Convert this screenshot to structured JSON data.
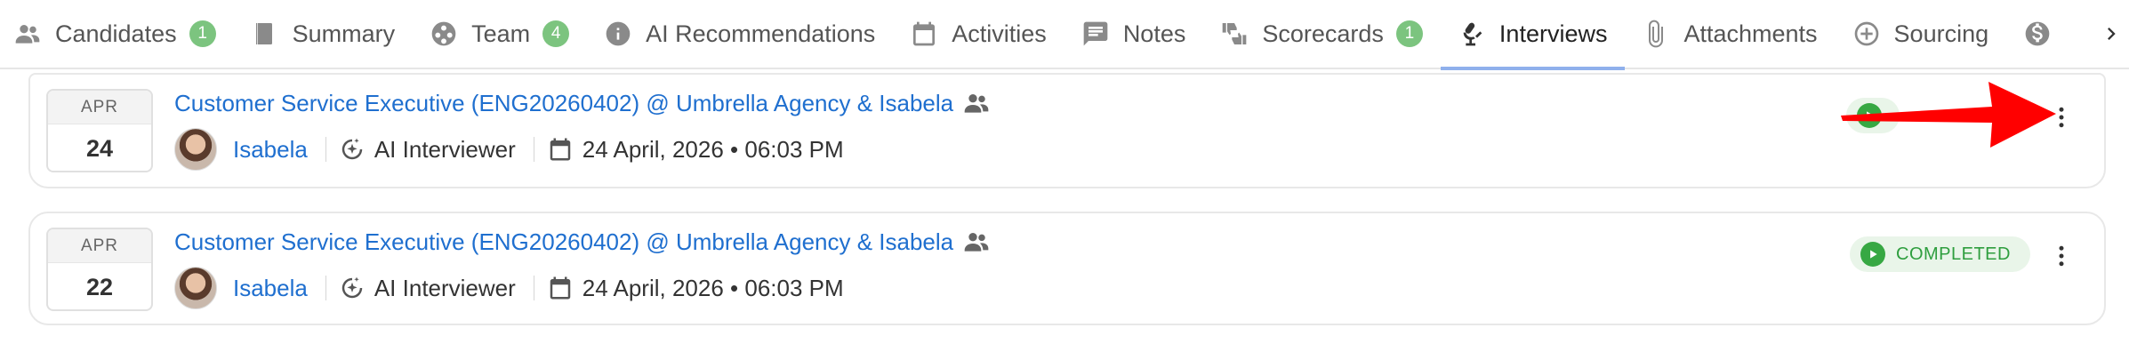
{
  "tabs": [
    {
      "key": "candidates",
      "label": "Candidates",
      "icon": "people-icon",
      "badge": "1"
    },
    {
      "key": "summary",
      "label": "Summary",
      "icon": "book-icon",
      "badge": null
    },
    {
      "key": "team",
      "label": "Team",
      "icon": "team-icon",
      "badge": "4"
    },
    {
      "key": "ai-recommendations",
      "label": "AI Recommendations",
      "icon": "info-icon",
      "badge": null
    },
    {
      "key": "activities",
      "label": "Activities",
      "icon": "calendar-icon",
      "badge": null
    },
    {
      "key": "notes",
      "label": "Notes",
      "icon": "comment-icon",
      "badge": null
    },
    {
      "key": "scorecards",
      "label": "Scorecards",
      "icon": "thumbs-icon",
      "badge": "1"
    },
    {
      "key": "interviews",
      "label": "Interviews",
      "icon": "microphone-icon",
      "badge": null,
      "active": true
    },
    {
      "key": "attachments",
      "label": "Attachments",
      "icon": "paperclip-icon",
      "badge": null
    },
    {
      "key": "sourcing",
      "label": "Sourcing",
      "icon": "plus-circle-icon",
      "badge": null
    }
  ],
  "interviews": [
    {
      "month": "APR",
      "day": "24",
      "title": "Customer Service Executive (ENG20260402) @ Umbrella Agency & Isabela",
      "person": "Isabela",
      "interviewer": "AI Interviewer",
      "datetime": "24 April, 2026 • 06:03 PM",
      "status": ""
    },
    {
      "month": "APR",
      "day": "22",
      "title": "Customer Service Executive (ENG20260402) @ Umbrella Agency & Isabela",
      "person": "Isabela",
      "interviewer": "AI Interviewer",
      "datetime": "24 April, 2026 • 06:03 PM",
      "status": "COMPLETED"
    }
  ],
  "colors": {
    "link": "#1f6fcf",
    "badge_green": "#7cc47f",
    "status_green": "#37a843",
    "active_underline": "#8fb0ec",
    "annotation_arrow": "#ff0000"
  }
}
